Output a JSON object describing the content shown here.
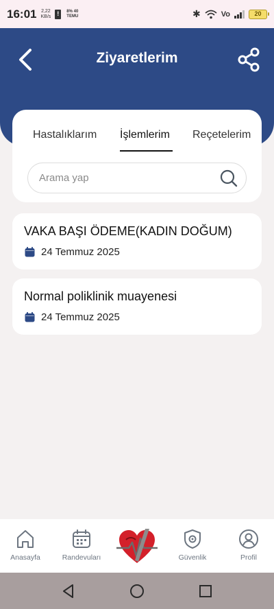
{
  "status_bar": {
    "time": "16:01",
    "speed_value": "2,22",
    "speed_unit": "KB/s",
    "temu_line1": "8%  40",
    "temu_line2": "TEMU",
    "volte": "Vo",
    "battery": "20"
  },
  "header": {
    "title": "Ziyaretlerim",
    "back_icon": "chevron-left-icon",
    "share_icon": "share-icon"
  },
  "tabs": [
    {
      "label": "Hastalıklarım",
      "active": false
    },
    {
      "label": "İşlemlerim",
      "active": true
    },
    {
      "label": "Reçetelerim",
      "active": false
    }
  ],
  "search": {
    "placeholder": "Arama yap",
    "value": ""
  },
  "visits": [
    {
      "title": "VAKA BAŞI ÖDEME(KADIN DOĞUM)",
      "date": "24 Temmuz 2025"
    },
    {
      "title": "Normal poliklinik muayenesi",
      "date": "24 Temmuz 2025"
    }
  ],
  "bottom_nav": [
    {
      "label": "Anasayfa",
      "icon": "home-icon"
    },
    {
      "label": "Randevuları",
      "icon": "calendar-icon"
    },
    {
      "label": "",
      "icon": "heart-logo-icon"
    },
    {
      "label": "Güvenlik",
      "icon": "shield-gear-icon"
    },
    {
      "label": "Profil",
      "icon": "user-icon"
    }
  ],
  "colors": {
    "header": "#2d4a86",
    "background": "#f4f1f1",
    "nav_label": "#6c7580",
    "system_nav": "#a89e9e"
  }
}
